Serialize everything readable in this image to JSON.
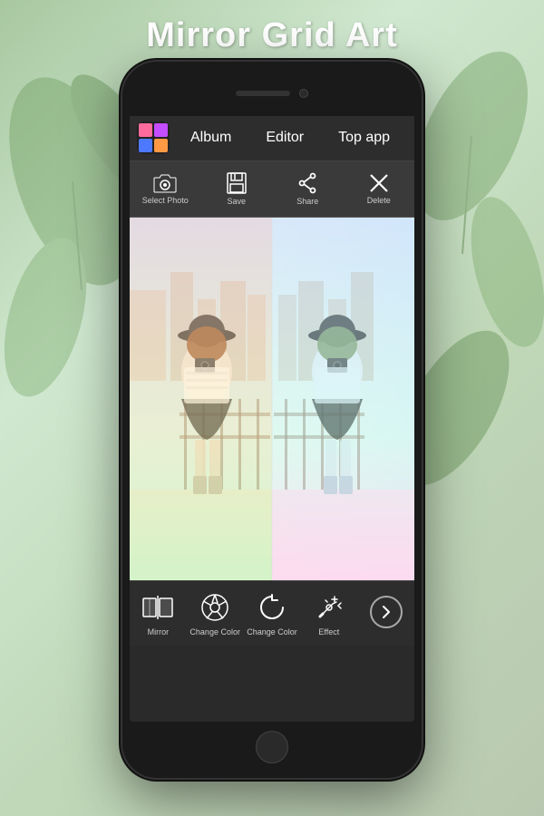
{
  "page": {
    "title": "Mirror Grid Art",
    "background_color": "#c8d8c0"
  },
  "phone": {
    "header": {
      "logo_alt": "app-logo",
      "nav_items": [
        {
          "label": "Album",
          "id": "album"
        },
        {
          "label": "Editor",
          "id": "editor"
        },
        {
          "label": "Top app",
          "id": "top-app"
        }
      ]
    },
    "toolbar": {
      "items": [
        {
          "label": "Select Photo",
          "icon": "camera"
        },
        {
          "label": "Save",
          "icon": "save"
        },
        {
          "label": "Share",
          "icon": "share"
        },
        {
          "label": "Delete",
          "icon": "close"
        }
      ]
    },
    "image_area": {
      "alt": "Mirror grid photo of woman with camera"
    },
    "bottom_bar": {
      "items": [
        {
          "label": "Mirror",
          "icon": "mirror"
        },
        {
          "label": "Change Color",
          "icon": "aperture"
        },
        {
          "label": "Change Color",
          "icon": "refresh"
        },
        {
          "label": "Effect",
          "icon": "sparkle"
        }
      ],
      "next_label": ""
    }
  }
}
